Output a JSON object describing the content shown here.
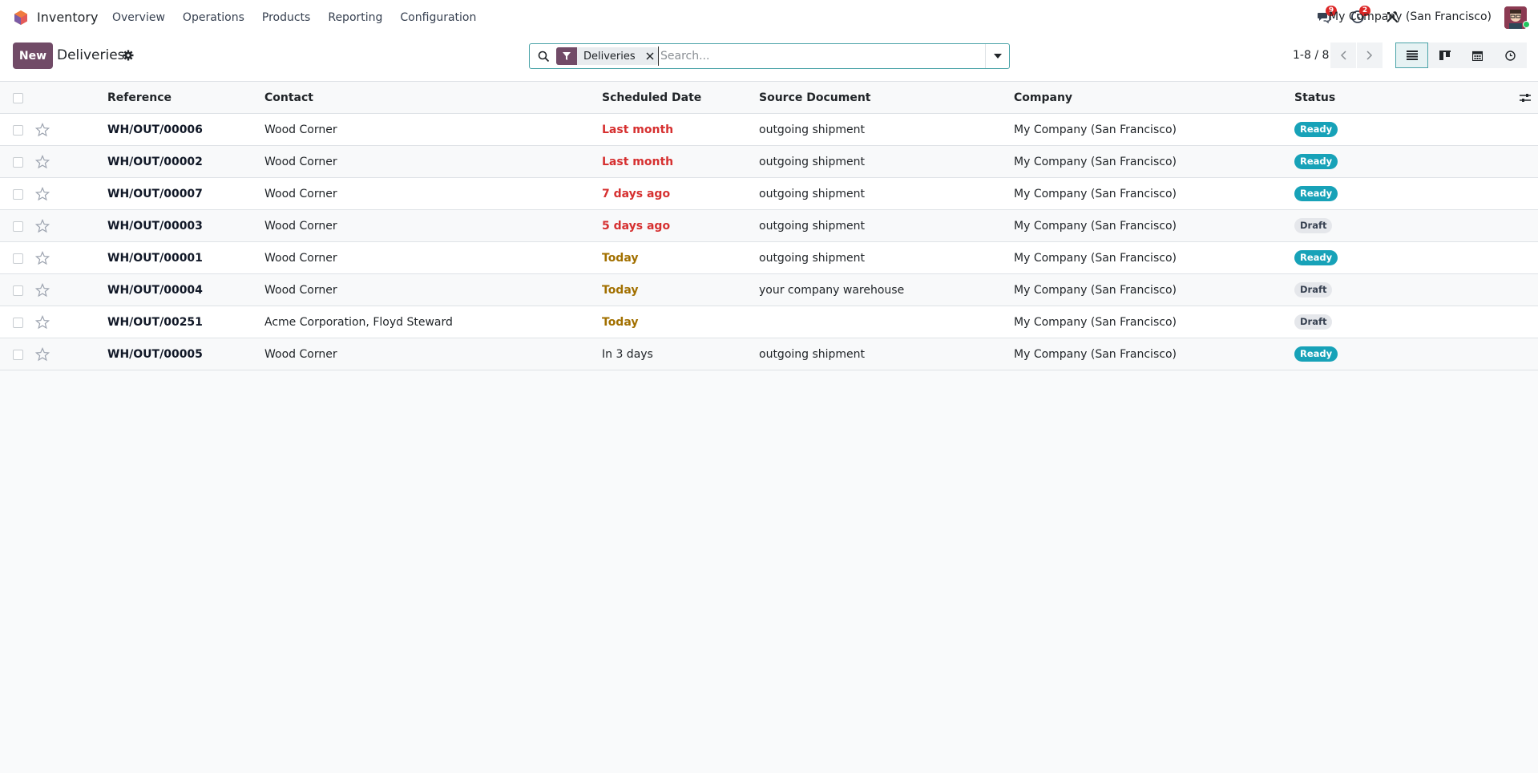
{
  "app": {
    "name": "Inventory",
    "logo_icon": "odoo-inventory-cube-icon"
  },
  "menu": [
    "Overview",
    "Operations",
    "Products",
    "Reporting",
    "Configuration"
  ],
  "systray": {
    "messages_count": "9",
    "activities_count": "2",
    "company": "My Company (San Francisco)"
  },
  "control": {
    "new_label": "New",
    "title": "Deliveries",
    "search": {
      "facet": "Deliveries",
      "placeholder": "Search..."
    },
    "pager": "1-8 / 8"
  },
  "table": {
    "headers": {
      "reference": "Reference",
      "contact": "Contact",
      "scheduled_date": "Scheduled Date",
      "source_document": "Source Document",
      "company": "Company",
      "status": "Status"
    },
    "rows": [
      {
        "reference": "WH/OUT/00006",
        "contact": "Wood Corner",
        "date": "Last month",
        "date_style": "red",
        "source": "outgoing shipment",
        "company": "My Company (San Francisco)",
        "status": "Ready"
      },
      {
        "reference": "WH/OUT/00002",
        "contact": "Wood Corner",
        "date": "Last month",
        "date_style": "red",
        "source": "outgoing shipment",
        "company": "My Company (San Francisco)",
        "status": "Ready"
      },
      {
        "reference": "WH/OUT/00007",
        "contact": "Wood Corner",
        "date": "7 days ago",
        "date_style": "red",
        "source": "outgoing shipment",
        "company": "My Company (San Francisco)",
        "status": "Ready"
      },
      {
        "reference": "WH/OUT/00003",
        "contact": "Wood Corner",
        "date": "5 days ago",
        "date_style": "red",
        "source": "outgoing shipment",
        "company": "My Company (San Francisco)",
        "status": "Draft"
      },
      {
        "reference": "WH/OUT/00001",
        "contact": "Wood Corner",
        "date": "Today",
        "date_style": "orange",
        "source": "outgoing shipment",
        "company": "My Company (San Francisco)",
        "status": "Ready"
      },
      {
        "reference": "WH/OUT/00004",
        "contact": "Wood Corner",
        "date": "Today",
        "date_style": "orange",
        "source": "your company warehouse",
        "company": "My Company (San Francisco)",
        "status": "Draft"
      },
      {
        "reference": "WH/OUT/00251",
        "contact": "Acme Corporation, Floyd Steward",
        "date": "Today",
        "date_style": "orange",
        "source": "",
        "company": "My Company (San Francisco)",
        "status": "Draft"
      },
      {
        "reference": "WH/OUT/00005",
        "contact": "Wood Corner",
        "date": "In 3 days",
        "date_style": "normal",
        "source": "outgoing shipment",
        "company": "My Company (San Francisco)",
        "status": "Ready"
      }
    ]
  },
  "colors": {
    "brand": "#714b67",
    "accent": "#4aa3a8",
    "status_ready": "#17a2b8",
    "date_overdue": "#d63030",
    "date_today": "#a27000"
  }
}
